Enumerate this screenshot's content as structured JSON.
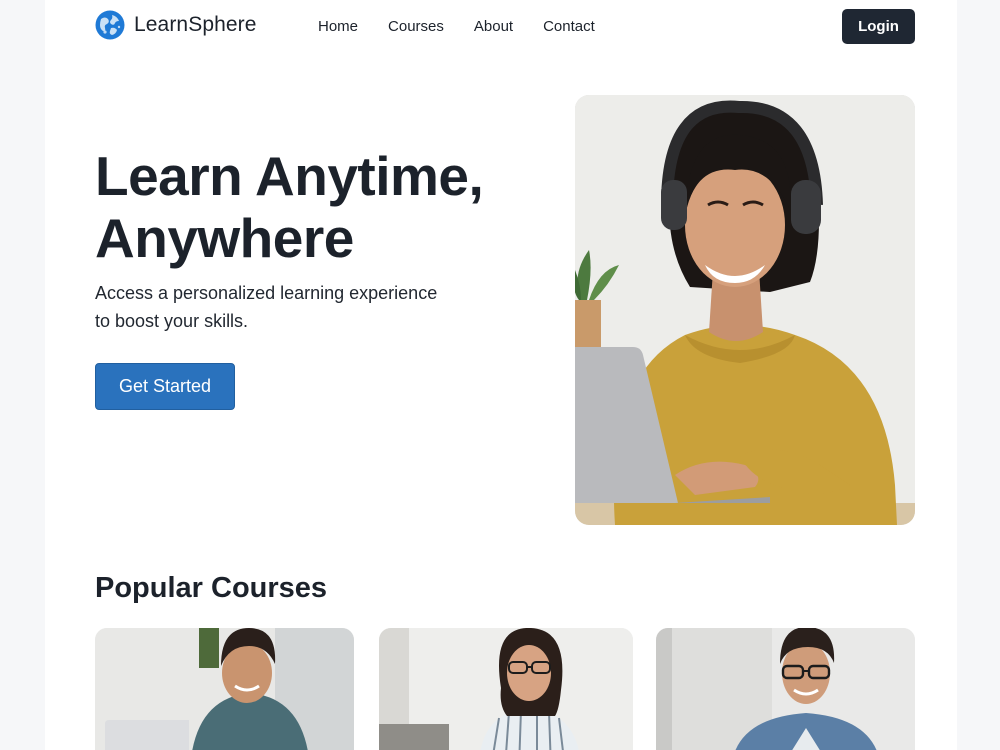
{
  "brand": {
    "name": "LearnSphere",
    "icon": "globe-icon",
    "accent": "#1f7ad6"
  },
  "nav": {
    "items": [
      "Home",
      "Courses",
      "About",
      "Contact"
    ]
  },
  "header": {
    "login_label": "Login"
  },
  "hero": {
    "title_line1": "Learn Anytime,",
    "title_line2": "Anywhere",
    "subtitle_line1": "Access a personalized learning experience",
    "subtitle_line2": "to boost your skills.",
    "cta_label": "Get Started",
    "cta_color": "#2a72bd",
    "image": "smiling woman with headphones using laptop"
  },
  "popular": {
    "title": "Popular Courses",
    "cards": [
      {
        "image": "man in teal t-shirt at laptop"
      },
      {
        "image": "woman with glasses in striped shirt at laptop"
      },
      {
        "image": "man with glasses in denim shirt"
      }
    ]
  }
}
